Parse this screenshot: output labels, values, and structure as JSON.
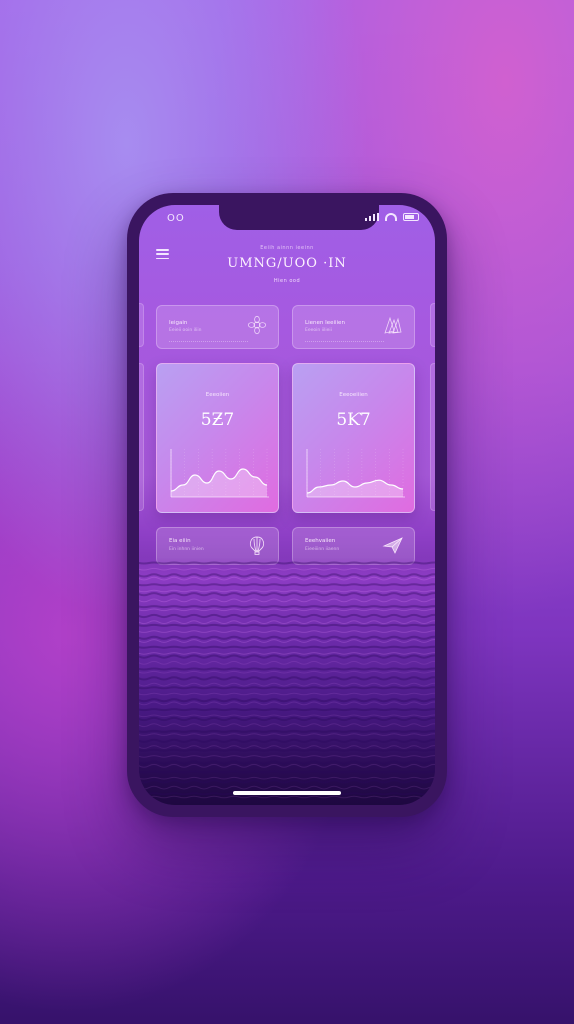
{
  "status_bar": {
    "time": "OO"
  },
  "header": {
    "top_small": "Eeiih ainnn ieeinn",
    "title": "UMNG/UOO ·IN",
    "subtitle": "Hien ood"
  },
  "top_cards": [
    {
      "label": "Ieigain",
      "sublabel": "Eeieii ooin iliin",
      "icon": "flower-icon"
    },
    {
      "label": "Lienen Ieeiiien",
      "sublabel": "Eeeoin iilieii",
      "icon": "cloth-icon"
    }
  ],
  "stat_cards": [
    {
      "title": "Eeeoiien",
      "value": "5Ƶ7",
      "chart_values": [
        0.15,
        0.3,
        0.55,
        0.35,
        0.65,
        0.45,
        0.7,
        0.5,
        0.3
      ],
      "line_color": "#ffffff"
    },
    {
      "title": "Eeeoeiiien",
      "value": "5Ƙ7",
      "chart_values": [
        0.1,
        0.25,
        0.3,
        0.4,
        0.25,
        0.35,
        0.42,
        0.3,
        0.2
      ],
      "line_color": "#ffffff"
    }
  ],
  "bottom_cards": [
    {
      "label": "Eia eiiin",
      "sublabel": "Ein inhnn iinien",
      "icon": "balloon-icon"
    },
    {
      "label": "Eeehvaiien",
      "sublabel": "Eieeiiinn iiaenn",
      "icon": "paper-plane-icon"
    }
  ],
  "colors": {
    "accent": "#e06be0",
    "screen_top": "#a05fe6",
    "water_deep": "#2a0c55"
  }
}
